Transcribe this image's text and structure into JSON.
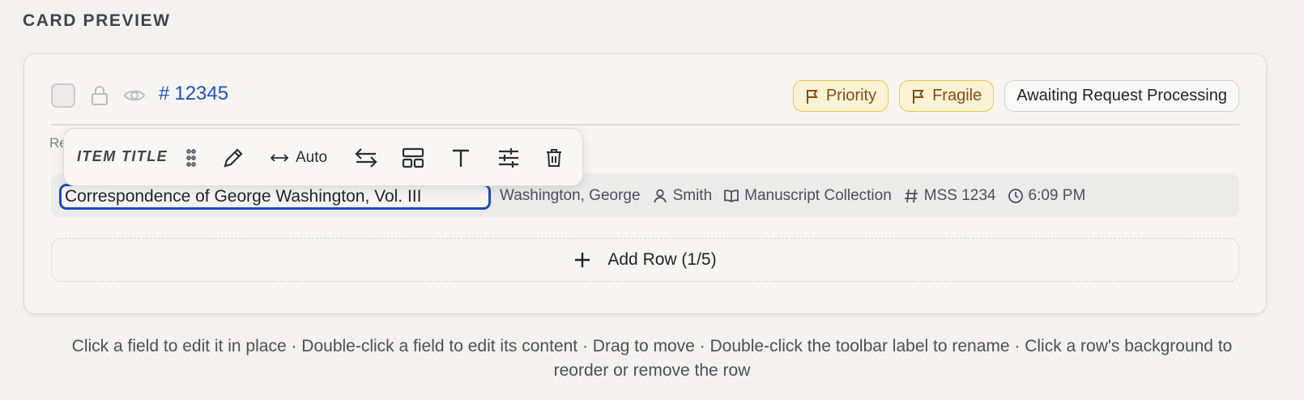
{
  "section": {
    "heading": "CARD PREVIEW"
  },
  "card": {
    "item_id": "12345",
    "item_id_prefix": "#",
    "badges": [
      {
        "label": "Priority",
        "kind": "flag"
      },
      {
        "label": "Fragile",
        "kind": "flag"
      },
      {
        "label": "Awaiting Request Processing",
        "kind": "status"
      }
    ],
    "row_label_peek": "Re",
    "row": {
      "title": "Correspondence of George Washington, Vol. III",
      "author": "Washington, George",
      "requester": "Smith",
      "collection": "Manuscript Collection",
      "call_number": "MSS 1234",
      "time": "6:09 PM"
    },
    "add_row_label": "Add Row (1/5)"
  },
  "toolbar": {
    "label": "ITEM TITLE",
    "width_label": "Auto"
  },
  "help_text": "Click a field to edit it in place · Double-click a field to edit its content · Drag to move · Double-click the toolbar label to rename · Click a row's background to reorder or remove the row",
  "colors": {
    "accent": "#1e47c6",
    "flag_bg": "#fbf3d5",
    "flag_border": "#f0c64a",
    "flag_text": "#8a4a14"
  }
}
